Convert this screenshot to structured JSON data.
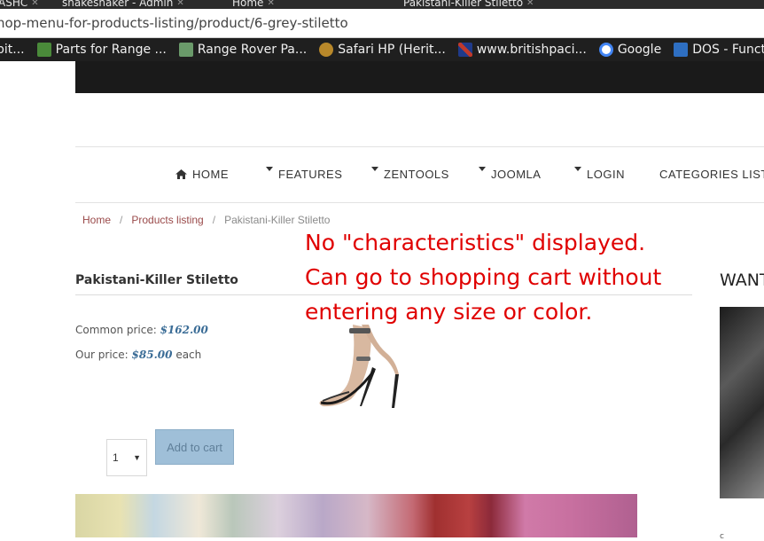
{
  "browser": {
    "tabs": [
      {
        "label": "ASHC"
      },
      {
        "label": "snakeshaker - Admin"
      },
      {
        "label": "Home"
      },
      {
        "label": "Pakistani-Killer Stiletto"
      }
    ],
    "address": "hop-menu-for-products-listing/product/6-grey-stiletto",
    "bookmarks": [
      {
        "label": "bit...",
        "icon": "bookmark-icon",
        "color": "#7a7a7a"
      },
      {
        "label": "Parts for Range ...",
        "icon": "car-icon",
        "color": "#4a8a3a"
      },
      {
        "label": "Range Rover Pa...",
        "icon": "image-icon",
        "color": "#6a9a6a"
      },
      {
        "label": "Safari HP (Herit...",
        "icon": "mask-icon",
        "color": "#b8882a"
      },
      {
        "label": "www.britishpaci...",
        "icon": "uk-flag-icon",
        "color": "#c0392b"
      },
      {
        "label": "Google",
        "icon": "google-icon",
        "color": "#4285f4"
      },
      {
        "label": "DOS - Function ...",
        "icon": "page-icon",
        "color": "#2e6fc2"
      }
    ]
  },
  "nav": {
    "items": [
      {
        "label": "HOME",
        "icon": "home-icon"
      },
      {
        "label": "FEATURES"
      },
      {
        "label": "ZENTOOLS"
      },
      {
        "label": "JOOMLA"
      },
      {
        "label": "LOGIN"
      },
      {
        "label": "CATEGORIES LISTIN"
      }
    ]
  },
  "breadcrumb": {
    "home": "Home",
    "sep": "/",
    "products": "Products listing",
    "current": "Pakistani-Killer Stiletto"
  },
  "product": {
    "title": "Pakistani-Killer Stiletto",
    "common_label": "Common price:",
    "common_price": "$162.00",
    "our_label": "Our price:",
    "our_price": "$85.00",
    "each": "each",
    "qty": "1",
    "add_to_cart": "Add to cart"
  },
  "annotation": {
    "line1": "No \"characteristics\" displayed.",
    "line2": "Can go to shopping cart without",
    "line3": "entering any size or color."
  },
  "sidebar": {
    "title": "WANT",
    "tag": "c"
  },
  "colors": {
    "accent": "#3a6c96",
    "annotation": "#e00000",
    "button": "#9fbfd8"
  }
}
